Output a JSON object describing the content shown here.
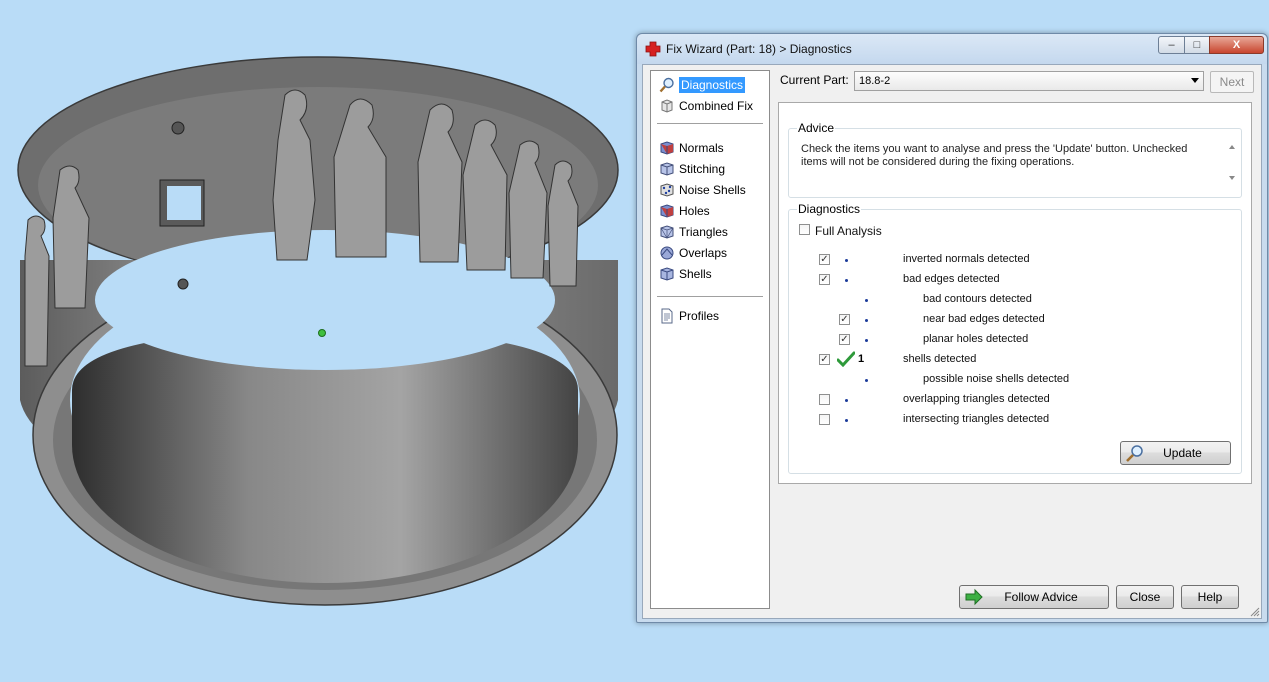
{
  "viewport": {
    "model": "3d-ring-with-relief-figures",
    "background": "#b9dcf7",
    "model_color": "#808080"
  },
  "dialog": {
    "title": "Fix Wizard (Part: 18) > Diagnostics",
    "title_icon": "red-cross-icon",
    "window_controls": {
      "minimize": "–",
      "maximize": "□",
      "close": "X"
    }
  },
  "nav": {
    "items": [
      {
        "label": "Diagnostics",
        "icon": "magnifier-icon",
        "selected": true
      },
      {
        "label": "Combined Fix",
        "icon": "cube-icon"
      },
      {
        "label": "Normals",
        "icon": "cube-normals-icon"
      },
      {
        "label": "Stitching",
        "icon": "cube-stitching-icon"
      },
      {
        "label": "Noise Shells",
        "icon": "noise-shells-icon"
      },
      {
        "label": "Holes",
        "icon": "cube-holes-icon"
      },
      {
        "label": "Triangles",
        "icon": "cube-triangles-icon"
      },
      {
        "label": "Overlaps",
        "icon": "overlaps-icon"
      },
      {
        "label": "Shells",
        "icon": "shells-icon"
      },
      {
        "label": "Profiles",
        "icon": "document-icon"
      }
    ]
  },
  "current_part": {
    "label": "Current Part:",
    "value": "18.8-2"
  },
  "buttons": {
    "next": "Next",
    "update": "Update",
    "follow_advice": "Follow Advice",
    "close": "Close",
    "help": "Help"
  },
  "advice": {
    "title": "Advice",
    "text": "Check the items you want to analyse and press the 'Update' button. Unchecked items will not be considered during the fixing operations."
  },
  "diagnostics": {
    "title": "Diagnostics",
    "full_analysis": {
      "label": "Full Analysis",
      "checked": false
    },
    "items": [
      {
        "label": "inverted normals detected",
        "checked": true,
        "indent": 0,
        "has_checkbox": true,
        "count": ""
      },
      {
        "label": "bad edges detected",
        "checked": true,
        "indent": 0,
        "has_checkbox": true,
        "count": ""
      },
      {
        "label": "bad contours detected",
        "checked": false,
        "indent": 1,
        "has_checkbox": false,
        "count": ""
      },
      {
        "label": "near bad edges detected",
        "checked": true,
        "indent": 1,
        "has_checkbox": true,
        "count": ""
      },
      {
        "label": "planar holes detected",
        "checked": true,
        "indent": 1,
        "has_checkbox": true,
        "count": ""
      },
      {
        "label": "shells detected",
        "checked": true,
        "indent": 0,
        "has_checkbox": true,
        "count": "1",
        "status": "ok"
      },
      {
        "label": "possible noise shells detected",
        "checked": false,
        "indent": 1,
        "has_checkbox": false,
        "count": ""
      },
      {
        "label": "overlapping triangles detected",
        "checked": false,
        "indent": 0,
        "has_checkbox": true,
        "count": ""
      },
      {
        "label": "intersecting triangles detected",
        "checked": false,
        "indent": 0,
        "has_checkbox": true,
        "count": ""
      }
    ]
  }
}
